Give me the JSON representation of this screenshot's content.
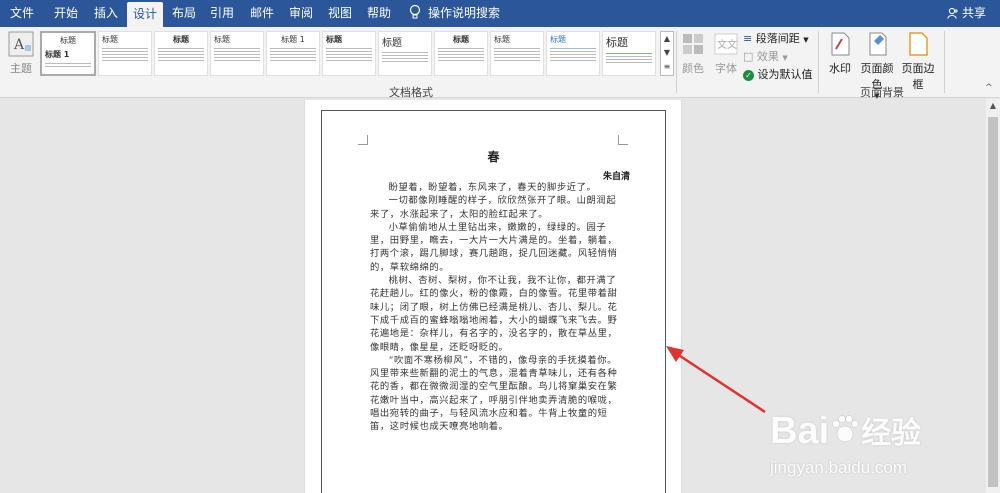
{
  "tabs": [
    "文件",
    "开始",
    "插入",
    "设计",
    "布局",
    "引用",
    "邮件",
    "审阅",
    "视图",
    "帮助"
  ],
  "active_tab": "设计",
  "tell_me": "操作说明搜索",
  "share": "共享",
  "ribbon": {
    "themes_label": "主题",
    "doc_format_label": "文档格式",
    "style_thumbs": [
      "标题 1",
      "标题",
      "标题",
      "标题",
      "标题",
      "标题 1",
      "标题",
      "标题",
      "标题",
      "标题",
      "标题"
    ],
    "colors_label": "颜色",
    "fonts_label": "字体",
    "paragraph_spacing": "段落间距",
    "effects": "效果",
    "set_default": "设为默认值",
    "watermark": "水印",
    "page_color": "页面颜色",
    "page_borders": "页面边框",
    "page_background_label": "页面背景"
  },
  "document": {
    "title": "春",
    "author": "朱自清",
    "paragraphs": [
      "盼望着，盼望着，东风来了，春天的脚步近了。",
      "一切都像刚睡醒的样子，欣欣然张开了眼。山朗润起来了，水涨起来了，太阳的脸红起来了。",
      "小草偷偷地从土里钻出来，嫩嫩的，绿绿的。园子里，田野里，瞧去，一大片一大片满是的。坐着，躺着，打两个滚，踢几脚球，赛几趟跑，捉几回迷藏。风轻悄悄的，草软绵绵的。",
      "桃树、杏树、梨树，你不让我，我不让你，都开满了花赶趟儿。红的像火，粉的像霞，白的像雪。花里带着甜味儿；闭了眼，树上仿佛已经满是桃儿、杏儿、梨儿。花下成千成百的蜜蜂嗡嗡地闹着，大小的蝴蝶飞来飞去。野花遍地是：杂样儿，有名字的，没名字的，散在草丛里，像眼睛，像星星，还眨呀眨的。",
      "“吹面不寒杨柳风”，不错的，像母亲的手抚摸着你。风里带来些新翻的泥土的气息，混着青草味儿，还有各种花的香，都在微微润湿的空气里酝酿。鸟儿将窠巢安在繁花嫩叶当中，高兴起来了，呼朋引伴地卖弄清脆的喉咙，唱出宛转的曲子，与轻风流水应和着。牛背上牧童的短笛，这时候也成天嘹亮地响着。"
    ]
  },
  "watermark_brand": "Bai",
  "watermark_brand_cn": "经验",
  "watermark_url": "jingyan.baidu.com",
  "colors": {
    "accent": "#2b579a",
    "arrow": "#e0322f"
  }
}
